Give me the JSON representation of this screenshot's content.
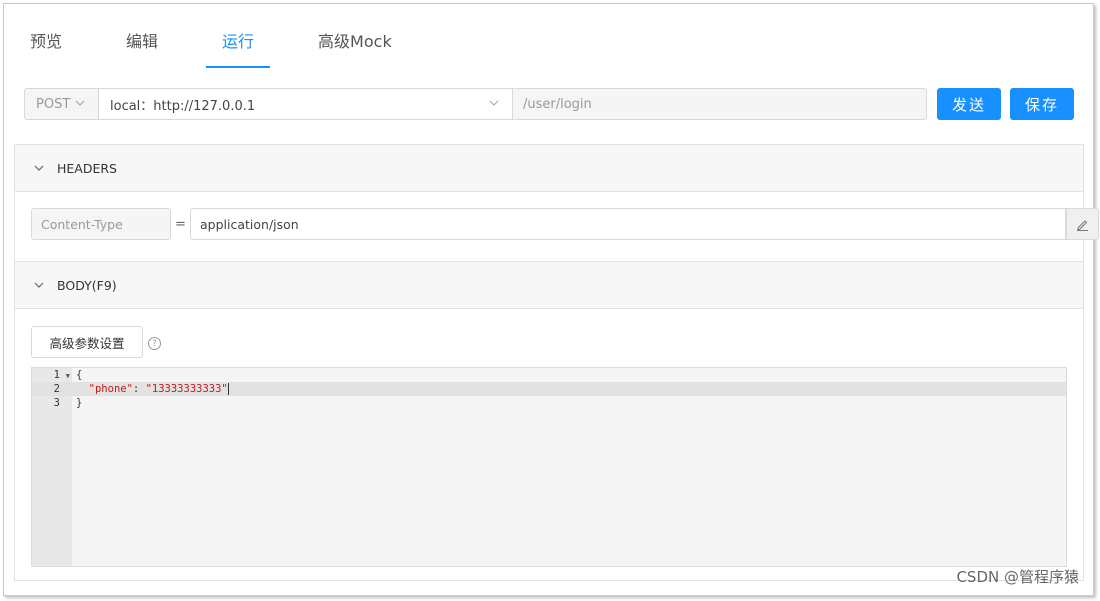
{
  "tabs": [
    {
      "label": "预览",
      "active": false
    },
    {
      "label": "编辑",
      "active": false
    },
    {
      "label": "运行",
      "active": true
    },
    {
      "label": "高级Mock",
      "active": false
    }
  ],
  "request": {
    "method": "POST",
    "env": "local：http://127.0.0.1",
    "path": "/user/login",
    "send_label": "发送",
    "save_label": "保存"
  },
  "headers_section": {
    "title": "HEADERS",
    "rows": [
      {
        "key_placeholder": "Content-Type",
        "separator": "=",
        "value": "application/json"
      }
    ]
  },
  "body_section": {
    "title": "BODY(F9)",
    "advanced_button": "高级参数设置",
    "help_glyph": "?",
    "editor": {
      "lines": [
        {
          "num": "1",
          "text": "{"
        },
        {
          "num": "2",
          "key": "\"phone\"",
          "colon": ": ",
          "value": "\"13333333333\""
        },
        {
          "num": "3",
          "text": "}"
        }
      ]
    }
  },
  "watermark": "CSDN @管程序猿",
  "colors": {
    "accent": "#1890ff",
    "string": "#c41a16"
  }
}
